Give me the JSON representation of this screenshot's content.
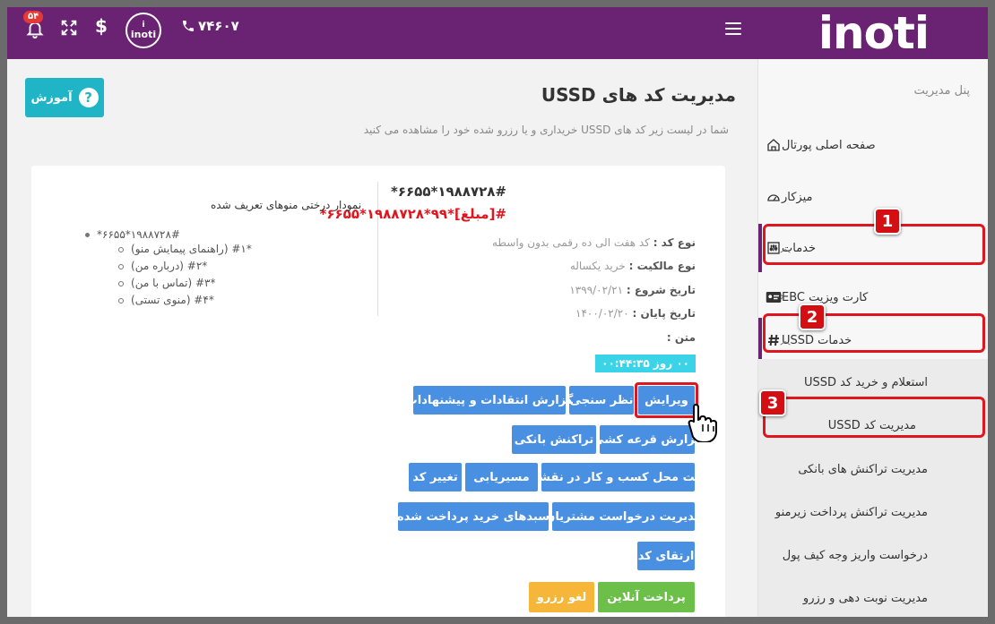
{
  "topbar": {
    "logo": "inoti",
    "notification_count": "۵۴",
    "avatar_line1": "i",
    "avatar_line2": "inoti",
    "phone": "۷۴۶۰۷"
  },
  "sidebar": {
    "title": "پنل مدیریت",
    "items": [
      {
        "label": "صفحه اصلی پورتال",
        "icon": "home-icon"
      },
      {
        "label": "میزکار",
        "icon": "dashboard-icon"
      },
      {
        "label": "خدمات",
        "icon": "sliders-icon"
      },
      {
        "label": "کارت ویزیت EBC",
        "icon": "id-card-icon"
      },
      {
        "label": "خدمات USSD",
        "icon": "hashtag-icon"
      }
    ],
    "sub_items": [
      {
        "label": "استعلام و خرید کد USSD"
      },
      {
        "label": "مدیریت کد USSD"
      },
      {
        "label": "مدیریت تراکنش های بانکی"
      },
      {
        "label": "مدیریت تراکنش پرداخت زیرمنو"
      },
      {
        "label": "درخواست واریز وجه کیف پول"
      },
      {
        "label": "مدیریت نوبت دهی و رزرو"
      }
    ]
  },
  "callouts": [
    "1",
    "2",
    "3"
  ],
  "main": {
    "title": "مدیریت کد های USSD",
    "subtitle": "شما در لیست زیر کد های USSD خریداری و یا رزرو شده خود را مشاهده می کنید",
    "help_label": "آموزش"
  },
  "code_card": {
    "code": "*۶۶۵۵*۱۹۸۸۷۲۸#",
    "code_with_amount": "*۶۶۵۵*۱۹۸۸۷۲۸*۹۹*[مبلغ]#",
    "type_label": "نوع کد :",
    "type_value": "کد هفت الی ده رقمی بدون واسطه",
    "ownership_label": "نوع مالکیت :",
    "ownership_value": "خرید یکساله",
    "start_label": "تاریخ شروع :",
    "start_value": "۱۳۹۹/۰۲/۲۱",
    "end_label": "تاریخ پایان :",
    "end_value": "۱۴۰۰/۰۲/۲۰",
    "text_label": "متن :",
    "timer": "۰۰ روز ۰۰:۴۴:۳۵",
    "tree_title": "نمودار درختی منوهای تعریف شده",
    "tree_root": "*۶۶۵۵*۱۹۸۸۷۲۸#",
    "tree_children": [
      "(راهنمای پیمایش منو) #۱*",
      "(درباره من) #۲*",
      "(تماس با من) #۳*",
      "(منوی تستی) #۴*"
    ],
    "buttons": {
      "edit": "ویرایش",
      "survey": "نظر سنجی",
      "feedback_report": "گزارش انتقادات و پیشنهادات",
      "lottery_report": "گزارش قرعه کشی",
      "bank_tx": "تراکنش بانکی",
      "register_location": "ثبت محل کسب و کار در نقشه",
      "routing": "مسیریابی",
      "change_code": "تغییر کد",
      "customer_requests": "مدیریت درخواست مشتریان",
      "paid_carts": "سبدهای خرید پرداخت شده",
      "upgrade": "ارتقای کد",
      "online_payment": "پرداخت آنلاین",
      "cancel_reserve": "لغو رزرو"
    }
  },
  "colors": {
    "brand": "#6a2373",
    "primary_button": "#4a90e2",
    "help_button": "#1fb5c7",
    "success": "#6cc04a",
    "warning": "#f5b63a",
    "alert": "#e0161e"
  }
}
